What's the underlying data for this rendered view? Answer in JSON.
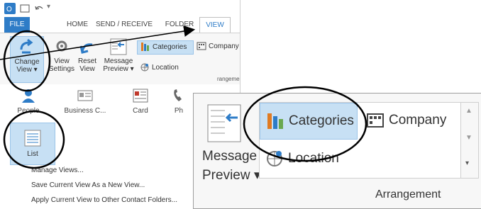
{
  "window": {
    "tabs": {
      "file": "FILE",
      "home": "HOME",
      "send_receive": "SEND / RECEIVE",
      "folder": "FOLDER",
      "view": "VIEW"
    }
  },
  "ribbon": {
    "change_view": {
      "line1": "Change",
      "line2": "View ▾"
    },
    "view_settings": {
      "line1": "View",
      "line2": "Settings"
    },
    "reset_view": {
      "line1": "Reset",
      "line2": "View"
    },
    "message_preview": {
      "line1": "Message",
      "line2": "Preview ▾"
    },
    "arrangement": {
      "categories": "Categories",
      "company": "Company",
      "location": "Location"
    },
    "group_label_partial": "rangement"
  },
  "gallery": {
    "items": [
      "People",
      "Business C...",
      "Card",
      "Ph"
    ],
    "list_label": "List",
    "menu": [
      "Manage Views...",
      "Save Current View As a New View...",
      "Apply Current View to Other Contact Folders..."
    ]
  },
  "zoom": {
    "message_preview": {
      "line1": "Message",
      "line2": "Preview ▾"
    },
    "categories": "Categories",
    "company": "Company",
    "location": "Location",
    "group_label": "Arrangement"
  },
  "icons": {
    "change_view": "change-view-icon",
    "view_settings": "gear-icon",
    "reset_view": "reset-icon",
    "message_preview": "message-preview-icon",
    "categories": "categories-icon",
    "company": "company-icon",
    "location": "location-icon",
    "people": "people-icon",
    "business_card": "business-card-icon",
    "card": "card-icon",
    "list": "list-icon"
  },
  "colors": {
    "accent": "#2e7cc7",
    "selected_fill": "#c7e0f4",
    "selected_border": "#9bc4e8",
    "annotation": "#000000"
  }
}
